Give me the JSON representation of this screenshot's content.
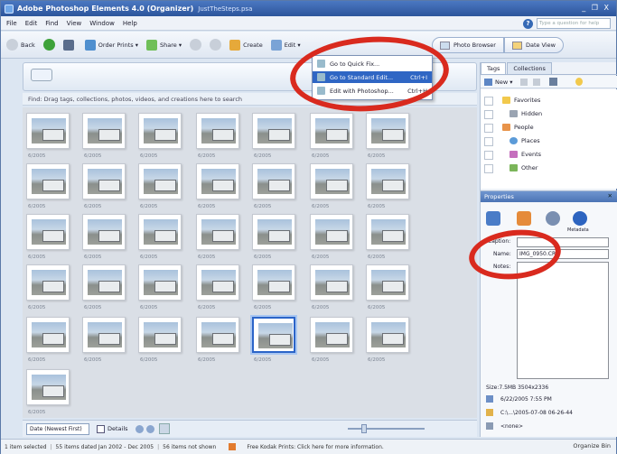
{
  "window": {
    "title": "Adobe Photoshop Elements 4.0 (Organizer)",
    "file": "JustTheSteps.psa",
    "controls": "_ ❐ X"
  },
  "menu": [
    "File",
    "Edit",
    "Find",
    "View",
    "Window",
    "Help"
  ],
  "help": {
    "placeholder": "Type a question for help"
  },
  "toolbar": {
    "back": "Back",
    "order_prints": "Order Prints ▾",
    "share": "Share ▾",
    "create": "Create",
    "edit": "Edit ▾"
  },
  "edit_menu": [
    {
      "label": "Go to Quick Fix...",
      "shortcut": ""
    },
    {
      "label": "Go to Standard Edit...",
      "shortcut": "Ctrl+I",
      "selected": true
    },
    {
      "label": "Edit with Photoshop...",
      "shortcut": "Ctrl+H"
    }
  ],
  "mode": {
    "photo_browser": "Photo Browser",
    "date_view": "Date View"
  },
  "find_bar": "Find: Drag tags, collections, photos, videos, and creations here to search",
  "date_label": "6/2005",
  "bottom": {
    "sort": "Date (Newest First)",
    "details": "Details"
  },
  "status": {
    "selected": "1 item selected",
    "dated": "55 items dated Jan 2002 - Dec 2005",
    "not_shown": "56 items not shown",
    "promo": "Free Kodak Prints: Click here for more information.",
    "organize_bin": "Organize Bin"
  },
  "right_panel": {
    "tabs": [
      "Tags",
      "Collections"
    ],
    "new_label": "New ▾",
    "tags": [
      "Favorites",
      "Hidden",
      "People",
      "Places",
      "Events",
      "Other"
    ],
    "properties_title": "Properties",
    "metadata_label": "Metadata",
    "caption_label": "Caption:",
    "name_label": "Name:",
    "notes_label": "Notes:",
    "caption_value": "",
    "name_value": "IMG_0950.CR2",
    "size": "Size:7.5MB  3504x2336",
    "date": "6/22/2005 7:55 PM",
    "path": "C:\\...\\2005-07-08 06-26-44",
    "audio": "<none>"
  },
  "accent": "#2f66c4",
  "annotation_color": "#d92a1e"
}
